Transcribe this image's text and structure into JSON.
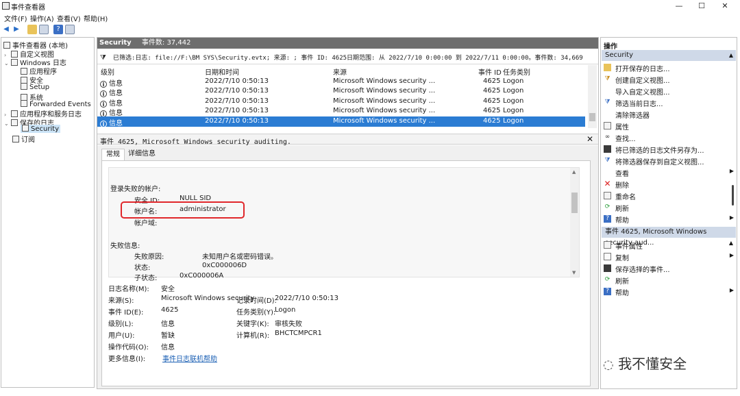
{
  "window": {
    "title": "事件查看器",
    "minimize": "—",
    "maximize": "☐",
    "close": "✕"
  },
  "menu": [
    "文件(F)",
    "操作(A)",
    "查看(V)",
    "帮助(H)"
  ],
  "tree": {
    "root": "事件查看器 (本地)",
    "custom_views": "自定义视图",
    "windows_logs": "Windows 日志",
    "windows_children": [
      "应用程序",
      "安全",
      "Setup",
      "系统",
      "Forwarded Events"
    ],
    "app_service_logs": "应用程序和服务日志",
    "saved_logs": "保存的日志",
    "saved_children": [
      "Security"
    ],
    "subscriptions": "订阅"
  },
  "log_header": {
    "name": "Security",
    "count_label": "事件数: 37,442"
  },
  "filter_text": "已筛选:日志: file://F:\\BM SYS\\Security.evtx; 来源: ; 事件 ID: 4625日期范围: 从 2022/7/10 0:00:00 到 2022/7/11 0:00:00。事件数: 34,669",
  "columns": [
    "级别",
    "日期和时间",
    "来源",
    "事件 ID",
    "任务类别"
  ],
  "events": [
    {
      "level": "信息",
      "time": "2022/7/10 0:50:13",
      "source": "Microsoft Windows security ...",
      "id": "4625",
      "task": "Logon"
    },
    {
      "level": "信息",
      "time": "2022/7/10 0:50:13",
      "source": "Microsoft Windows security ...",
      "id": "4625",
      "task": "Logon"
    },
    {
      "level": "信息",
      "time": "2022/7/10 0:50:13",
      "source": "Microsoft Windows security ...",
      "id": "4625",
      "task": "Logon"
    },
    {
      "level": "信息",
      "time": "2022/7/10 0:50:13",
      "source": "Microsoft Windows security ...",
      "id": "4625",
      "task": "Logon"
    },
    {
      "level": "信息",
      "time": "2022/7/10 0:50:13",
      "source": "Microsoft Windows security ...",
      "id": "4625",
      "task": "Logon"
    }
  ],
  "detail": {
    "title": "事件 4625, Microsoft Windows security auditing.",
    "tabs": [
      "常规",
      "详细信息"
    ],
    "section1": "登录失败的帐户:",
    "sid_label": "安全 ID:",
    "sid_value": "NULL SID",
    "account_label": "帐户名:",
    "account_value": "administrator",
    "domain_label": "帐户域:",
    "section2": "失败信息:",
    "reason_label": "失败原因:",
    "reason_value": "未知用户名或密码错误。",
    "status_label": "状态:",
    "status_value": "0xC000006D",
    "substatus_label": "子状态:",
    "substatus_value": "0xC000006A"
  },
  "meta": {
    "log_name_label": "日志名称(M):",
    "log_name": "安全",
    "source_label": "来源(S):",
    "source": "Microsoft Windows security",
    "logged_label": "记录时间(D):",
    "logged": "2022/7/10 0:50:13",
    "event_id_label": "事件 ID(E):",
    "event_id": "4625",
    "task_label": "任务类别(Y):",
    "task": "Logon",
    "level_label": "级别(L):",
    "level": "信息",
    "keywords_label": "关键字(K):",
    "keywords": "审核失败",
    "user_label": "用户(U):",
    "user": "暂缺",
    "computer_label": "计算机(R):",
    "computer": "BHCTCMPCR1",
    "opcode_label": "操作代码(O):",
    "opcode": "信息",
    "more_label": "更多信息(I):",
    "more_link": "事件日志联机帮助"
  },
  "actions": {
    "header": "操作",
    "section1": "Security",
    "items1": [
      "打开保存的日志...",
      "创建自定义视图...",
      "导入自定义视图...",
      "筛选当前日志...",
      "清除筛选器",
      "属性",
      "查找...",
      "将已筛选的日志文件另存为...",
      "将筛选器保存到自定义视图...",
      "查看",
      "删除",
      "重命名",
      "刷新",
      "帮助"
    ],
    "section2": "事件 4625, Microsoft Windows security aud...",
    "items2": [
      "事件属性",
      "复制",
      "保存选择的事件...",
      "刷新",
      "帮助"
    ]
  },
  "watermark": "我不懂安全",
  "colors": {
    "selection": "#2b7cd3",
    "header_dark": "#6e6e6e",
    "highlight_box": "#e0262a",
    "action_section": "#cfd9e8"
  }
}
